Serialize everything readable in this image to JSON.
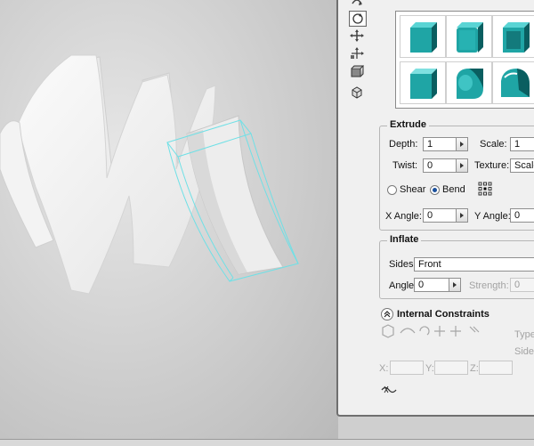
{
  "extrude": {
    "title": "Extrude",
    "depth_label": "Depth:",
    "depth_value": "1",
    "scale_label": "Scale:",
    "scale_value": "1",
    "twist_label": "Twist:",
    "twist_value": "0",
    "texture_label": "Texture:",
    "texture_value": "Scale",
    "shear_label": "Shear",
    "bend_label": "Bend",
    "selected_mode": "Bend",
    "x_angle_label": "X Angle:",
    "x_angle_value": "0",
    "y_angle_label": "Y Angle:",
    "y_angle_value": "0"
  },
  "inflate": {
    "title": "Inflate",
    "sides_label": "Sides:",
    "sides_value": "Front",
    "angle_label": "Angle:",
    "angle_value": "0",
    "strength_label": "Strength:",
    "strength_value": "0"
  },
  "constraints": {
    "title": "Internal Constraints",
    "type_label": "Type:",
    "side_label": "Side:",
    "x_label": "X:",
    "y_label": "Y:",
    "z_label": "Z:"
  },
  "colors": {
    "teal": "#1fa5a5",
    "teal_dark": "#0d6f72",
    "selection": "#6fe0e6"
  },
  "icons": [
    "move-icon",
    "rotate-icon",
    "pan-icon",
    "scale-icon",
    "cube-icon"
  ]
}
